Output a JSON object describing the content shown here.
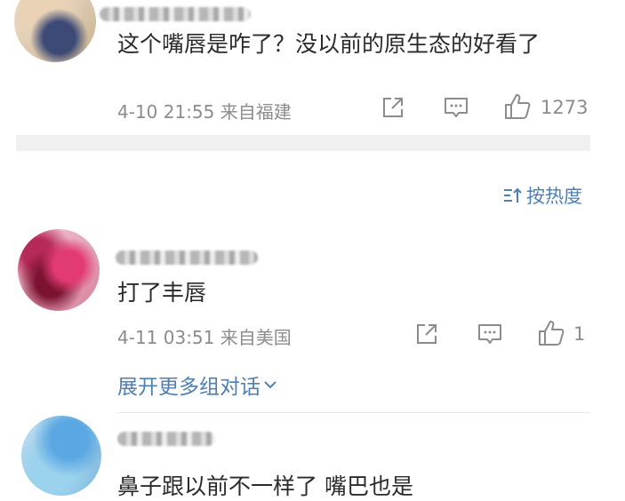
{
  "comments": [
    {
      "text": "这个嘴唇是咋了？没以前的原生态的好看了",
      "time": "4-10 21:55",
      "location": "来自福建",
      "likes": "1273"
    },
    {
      "text": "打了丰唇",
      "time": "4-11 03:51",
      "location": "来自美国",
      "likes": "1",
      "expand_label": "展开更多组对话"
    },
    {
      "text": "鼻子跟以前不一样了 嘴巴也是"
    }
  ],
  "sort": {
    "label": "按热度",
    "icon": "sort-icon"
  },
  "icons": {
    "share": "share-icon",
    "reply": "comment-icon",
    "like": "thumbs-up-icon",
    "expand": "chevron-down-icon"
  },
  "colors": {
    "link": "#4d7fb5",
    "meta": "#8c8c8c",
    "text": "#2b2b2b",
    "divider": "#f0f0f0"
  }
}
